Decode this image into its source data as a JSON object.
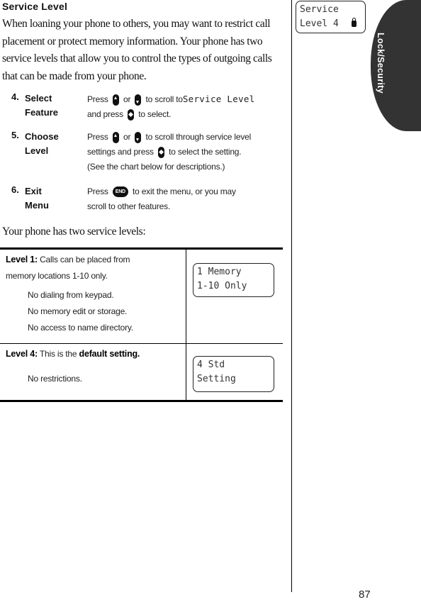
{
  "section": {
    "title": "Service Level",
    "intro": "When loaning your phone to others, you may want to restrict call placement or protect memory information. Your phone has two service levels that allow you to control the types of outgoing calls that can be made from your phone."
  },
  "steps": [
    {
      "number": "4.",
      "label_line1": "Select",
      "label_line2": "Feature",
      "text_a": "Press",
      "text_or": "or",
      "text_b": "to scroll to",
      "display_text": "Service Level",
      "text_c": "and press",
      "text_d": "to select."
    },
    {
      "number": "5.",
      "label_line1": "Choose",
      "label_line2": "Level",
      "text_a": "Press",
      "text_or": "or",
      "text_b": "to scroll through service level",
      "text_c": "settings and press",
      "text_d": "to select the setting.",
      "text_e": "(See the chart below for descriptions.)"
    },
    {
      "number": "6.",
      "label_line1": "Exit",
      "label_line2": "Menu",
      "text_a": "Press",
      "key_label": "END",
      "text_b": "to exit the menu, or you may",
      "text_c": "scroll to other features."
    }
  ],
  "levels_intro": "Your phone has two service levels:",
  "levels": [
    {
      "heading": "Level 1:",
      "description_line1": "Calls can be placed from",
      "description_line2": "memory locations 1-10 only.",
      "restrictions": [
        "No dialing from keypad.",
        "No memory edit or storage.",
        "No access to name directory."
      ],
      "display": "1 Memory\n1-10 Only"
    },
    {
      "heading": "Level 4:",
      "description_prefix": "This is the",
      "description_bold": "default setting.",
      "restrictions": [
        "No restrictions."
      ],
      "display": "4 Std\nSetting"
    }
  ],
  "sidebar": {
    "display_line1": "Service",
    "display_line2": "Level 4",
    "display_icon": "lock-icon",
    "tab_label": "Lock/Security"
  },
  "page_number": "87"
}
